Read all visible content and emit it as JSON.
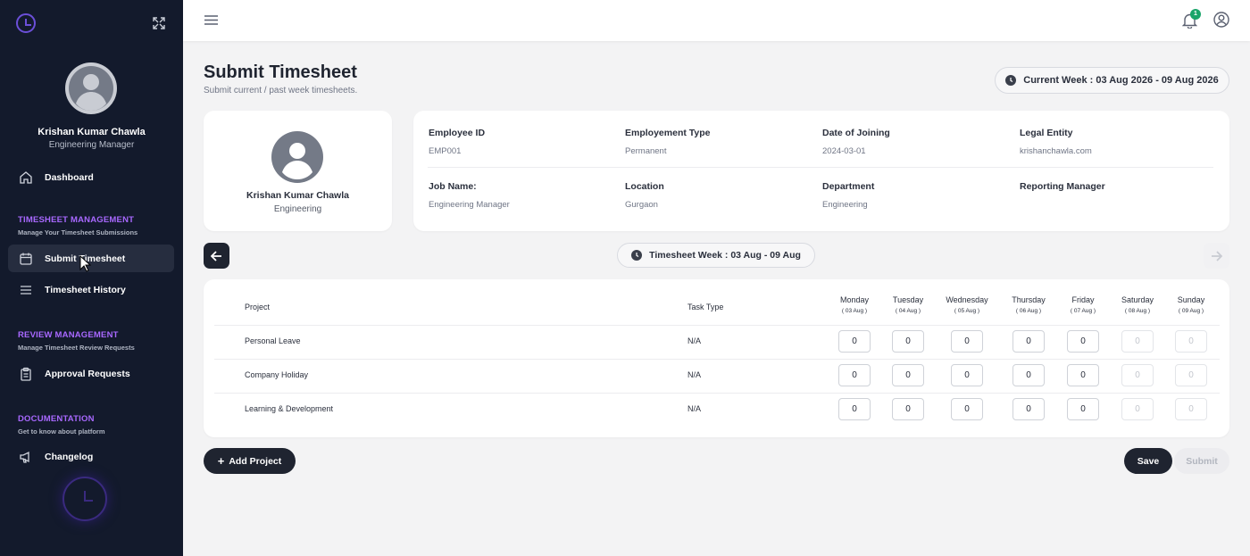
{
  "sidebar": {
    "user": {
      "name": "Krishan Kumar Chawla",
      "role": "Engineering Manager"
    },
    "dashboard_label": "Dashboard",
    "sections": [
      {
        "title": "TIMESHEET MANAGEMENT",
        "subtitle": "Manage Your Timesheet Submissions",
        "items": [
          {
            "label": "Submit Timesheet",
            "active": true
          },
          {
            "label": "Timesheet History"
          }
        ]
      },
      {
        "title": "REVIEW MANAGEMENT",
        "subtitle": "Manage Timesheet Review Requests",
        "items": [
          {
            "label": "Approval Requests"
          }
        ]
      },
      {
        "title": "DOCUMENTATION",
        "subtitle": "Get to know about platform",
        "items": [
          {
            "label": "Changelog"
          }
        ]
      }
    ],
    "accent_color": "#a868ff"
  },
  "topbar": {
    "notification_count": "1"
  },
  "page": {
    "title": "Submit Timesheet",
    "subtitle": "Submit current / past week timesheets.",
    "current_week": "Current Week : 03 Aug 2026 - 09 Aug 2026"
  },
  "profile_card": {
    "name": "Krishan Kumar Chawla",
    "department": "Engineering"
  },
  "employee_info": {
    "employee_id": {
      "label": "Employee ID",
      "value": "EMP001"
    },
    "employment_type": {
      "label": "Employement Type",
      "value": "Permanent"
    },
    "date_of_joining": {
      "label": "Date of Joining",
      "value": "2024-03-01"
    },
    "legal_entity": {
      "label": "Legal Entity",
      "value": "krishanchawla.com"
    },
    "job_name": {
      "label": "Job Name:",
      "value": "Engineering Manager"
    },
    "location": {
      "label": "Location",
      "value": "Gurgaon"
    },
    "department": {
      "label": "Department",
      "value": "Engineering"
    },
    "reporting_manager": {
      "label": "Reporting Manager",
      "value": ""
    }
  },
  "timesheet": {
    "week_label": "Timesheet Week : 03 Aug - 09 Aug",
    "headers": {
      "project": "Project",
      "task_type": "Task Type"
    },
    "days": [
      {
        "day": "Monday",
        "date": "( 03 Aug )"
      },
      {
        "day": "Tuesday",
        "date": "( 04 Aug )"
      },
      {
        "day": "Wednesday",
        "date": "( 05 Aug )"
      },
      {
        "day": "Thursday",
        "date": "( 06 Aug )"
      },
      {
        "day": "Friday",
        "date": "( 07 Aug )"
      },
      {
        "day": "Saturday",
        "date": "( 08 Aug )"
      },
      {
        "day": "Sunday",
        "date": "( 09 Aug )"
      }
    ],
    "rows": [
      {
        "project": "Personal Leave",
        "task_type": "N/A",
        "hours": [
          "0",
          "0",
          "0",
          "0",
          "0",
          "0",
          "0"
        ]
      },
      {
        "project": "Company Holiday",
        "task_type": "N/A",
        "hours": [
          "0",
          "0",
          "0",
          "0",
          "0",
          "0",
          "0"
        ]
      },
      {
        "project": "Learning & Development",
        "task_type": "N/A",
        "hours": [
          "0",
          "0",
          "0",
          "0",
          "0",
          "0",
          "0"
        ]
      }
    ]
  },
  "actions": {
    "add_project": "Add Project",
    "save": "Save",
    "submit": "Submit"
  }
}
